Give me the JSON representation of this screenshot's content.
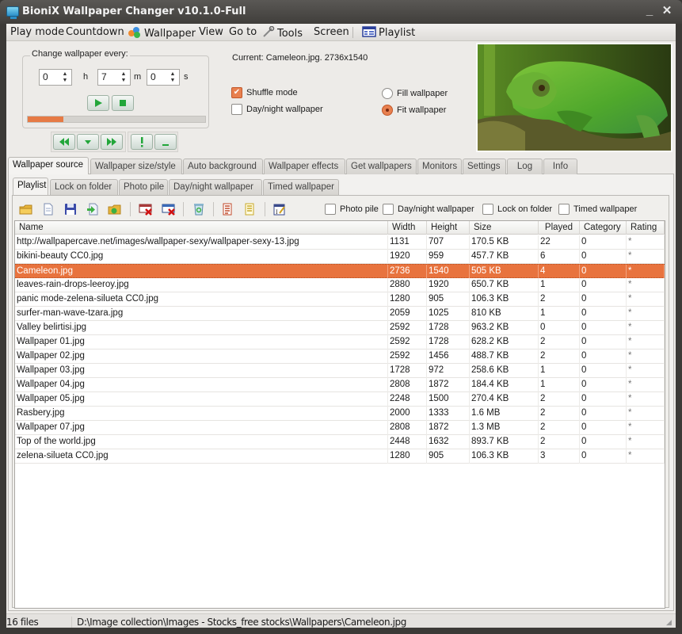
{
  "window": {
    "title": "BioniX Wallpaper Changer v10.1.0-Full",
    "minimize_label": "_",
    "close_label": "✕"
  },
  "menu": [
    {
      "label": "Play mode",
      "icon": null
    },
    {
      "label": "Countdown",
      "icon": null
    },
    {
      "label": "Wallpaper",
      "icon": "balls-icon"
    },
    {
      "label": "View",
      "icon": null
    },
    {
      "label": "Go to",
      "icon": null
    },
    {
      "label": "Tools",
      "icon": "wrench-icon"
    },
    {
      "label": "Screen",
      "icon": null
    },
    {
      "label": "Playlist",
      "icon": "playlist-icon"
    }
  ],
  "timer": {
    "group_title": "Change wallpaper every:",
    "hours": "0",
    "minutes": "7",
    "seconds": "0",
    "h_label": "h",
    "m_label": "m",
    "s_label": "s",
    "progress_percent": 20
  },
  "current": {
    "label": "Current: Cameleon.jpg.  2736x1540"
  },
  "options": {
    "shuffle_mode": {
      "label": "Shuffle mode",
      "checked": true
    },
    "day_night": {
      "label": "Day/night wallpaper",
      "checked": false
    },
    "fill_wallpaper": {
      "label": "Fill wallpaper",
      "selected": false
    },
    "fit_wallpaper": {
      "label": "Fit wallpaper",
      "selected": true
    }
  },
  "main_tabs": [
    {
      "label": "Wallpaper source",
      "active": true
    },
    {
      "label": "Wallpaper size/style",
      "active": false
    },
    {
      "label": "Auto background",
      "active": false
    },
    {
      "label": "Wallpaper effects",
      "active": false
    },
    {
      "label": "Get wallpapers",
      "active": false
    },
    {
      "label": "Monitors",
      "active": false
    },
    {
      "label": "Settings",
      "active": false
    },
    {
      "label": "Log",
      "active": false
    },
    {
      "label": "Info",
      "active": false
    }
  ],
  "sub_tabs": [
    {
      "label": "Playlist",
      "active": true
    },
    {
      "label": "Lock on folder",
      "active": false
    },
    {
      "label": "Photo pile",
      "active": false
    },
    {
      "label": "Day/night wallpaper",
      "active": false
    },
    {
      "label": "Timed wallpaper",
      "active": false
    }
  ],
  "toolbar": {
    "buttons": [
      "open-folder-icon",
      "new-file-icon",
      "save-icon",
      "import-icon",
      "add-folder-icon",
      "remove-icon",
      "remove-all-icon",
      "recycle-icon",
      "list-red-icon",
      "list-yellow-icon",
      "edit-icon"
    ],
    "checks": [
      {
        "label": "Photo pile",
        "checked": false
      },
      {
        "label": "Day/night wallpaper",
        "checked": false
      },
      {
        "label": "Lock on folder",
        "checked": false
      },
      {
        "label": "Timed wallpaper",
        "checked": false
      }
    ]
  },
  "table": {
    "columns": [
      "Name",
      "Width",
      "Height",
      "Size",
      "Played",
      "Category",
      "Rating"
    ],
    "rows": [
      [
        "http://wallpapercave.net/images/wallpaper-sexy/wallpaper-sexy-13.jpg",
        "1131",
        "707",
        "170.5 KB",
        "22",
        "0",
        "*"
      ],
      [
        "bikini-beauty CC0.jpg",
        "1920",
        "959",
        "457.7 KB",
        "6",
        "0",
        "*"
      ],
      [
        "Cameleon.jpg",
        "2736",
        "1540",
        "505 KB",
        "4",
        "0",
        "*"
      ],
      [
        "leaves-rain-drops-leeroy.jpg",
        "2880",
        "1920",
        "650.7 KB",
        "1",
        "0",
        "*"
      ],
      [
        "panic mode-zelena-silueta CC0.jpg",
        "1280",
        "905",
        "106.3 KB",
        "2",
        "0",
        "*"
      ],
      [
        "surfer-man-wave-tzara.jpg",
        "2059",
        "1025",
        "810 KB",
        "1",
        "0",
        "*"
      ],
      [
        "Valley belirtisi.jpg",
        "2592",
        "1728",
        "963.2 KB",
        "0",
        "0",
        "*"
      ],
      [
        "Wallpaper 01.jpg",
        "2592",
        "1728",
        "628.2 KB",
        "2",
        "0",
        "*"
      ],
      [
        "Wallpaper 02.jpg",
        "2592",
        "1456",
        "488.7 KB",
        "2",
        "0",
        "*"
      ],
      [
        "Wallpaper 03.jpg",
        "1728",
        "972",
        "258.6 KB",
        "1",
        "0",
        "*"
      ],
      [
        "Wallpaper 04.jpg",
        "2808",
        "1872",
        "184.4 KB",
        "1",
        "0",
        "*"
      ],
      [
        "Wallpaper 05.jpg",
        "2248",
        "1500",
        "270.4 KB",
        "2",
        "0",
        "*"
      ],
      [
        "Rasbery.jpg",
        "2000",
        "1333",
        "1.6 MB",
        "2",
        "0",
        "*"
      ],
      [
        "Wallpaper 07.jpg",
        "2808",
        "1872",
        "1.3 MB",
        "2",
        "0",
        "*"
      ],
      [
        "Top of the world.jpg",
        "2448",
        "1632",
        "893.7 KB",
        "2",
        "0",
        "*"
      ],
      [
        "zelena-silueta CC0.jpg",
        "1280",
        "905",
        "106.3 KB",
        "3",
        "0",
        "*"
      ]
    ],
    "selected_index": 2
  },
  "status": {
    "count": "16 files",
    "path": "D:\\Image collection\\Images - Stocks_free stocks\\Wallpapers\\Cameleon.jpg"
  },
  "colors": {
    "accent": "#e8733e",
    "progress": "#e67a45",
    "control_green": "#22a63a"
  }
}
